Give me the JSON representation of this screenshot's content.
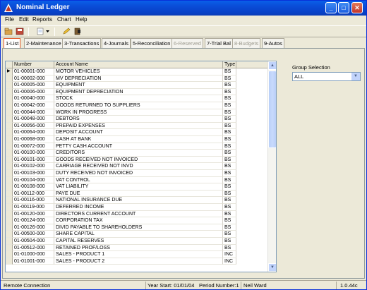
{
  "window": {
    "title": "Nominal Ledger"
  },
  "titlebar_buttons": {
    "minimize": "_",
    "maximize": "□",
    "close": "✕"
  },
  "menu": [
    {
      "label": "File"
    },
    {
      "label": "Edit"
    },
    {
      "label": "Reports"
    },
    {
      "label": "Chart"
    },
    {
      "label": "Help"
    }
  ],
  "toolbar": {
    "icons": [
      "open-icon",
      "save-icon",
      "new-document-icon",
      "dropdown-arrow-icon",
      "pencil-icon",
      "exit-icon"
    ]
  },
  "tabs": [
    {
      "label": "1-List",
      "state": "active"
    },
    {
      "label": "2-Maintenance",
      "state": "normal"
    },
    {
      "label": "3-Transactions",
      "state": "normal"
    },
    {
      "label": "4-Journals",
      "state": "normal"
    },
    {
      "label": "5-Reconciliation",
      "state": "normal"
    },
    {
      "label": "6-Reserved",
      "state": "disabled"
    },
    {
      "label": "7-Trial Bal",
      "state": "normal"
    },
    {
      "label": "8-Budgets",
      "state": "disabled"
    },
    {
      "label": "9-Autos",
      "state": "normal"
    }
  ],
  "grid": {
    "columns": [
      "Number",
      "Account Name",
      "Type"
    ],
    "rows": [
      [
        "01-00001-000",
        "MOTOR VEHICLES",
        "BS"
      ],
      [
        "01-00002-000",
        "MV DEPRECIATION",
        "BS"
      ],
      [
        "01-00005-000",
        "EQUIPMENT",
        "BS"
      ],
      [
        "01-00006-000",
        "EQUIPMENT DEPRECIATION",
        "BS"
      ],
      [
        "01-00040-000",
        "STOCK",
        "BS"
      ],
      [
        "01-00042-000",
        "GOODS RETURNED TO SUPPLIERS",
        "BS"
      ],
      [
        "01-00044-000",
        "WORK IN PROGRESS",
        "BS"
      ],
      [
        "01-00048-000",
        "DEBTORS",
        "BS"
      ],
      [
        "01-00056-000",
        "PREPAID EXPENSES",
        "BS"
      ],
      [
        "01-00064-000",
        "DEPOSIT ACCOUNT",
        "BS"
      ],
      [
        "01-00068-000",
        "CASH AT BANK",
        "BS"
      ],
      [
        "01-00072-000",
        "PETTY CASH ACCOUNT",
        "BS"
      ],
      [
        "01-00100-000",
        "CREDITORS",
        "BS"
      ],
      [
        "01-00101-000",
        "GOODS RECEIVED NOT  INVOICED",
        "BS"
      ],
      [
        "01-00102-000",
        "CARRIAGE RECEIVED NOT  INVD",
        "BS"
      ],
      [
        "01-00103-000",
        "DUTY RECEIVED NOT  INVOICED",
        "BS"
      ],
      [
        "01-00104-000",
        "VAT CONTROL",
        "BS"
      ],
      [
        "01-00108-000",
        "VAT LIABILITY",
        "BS"
      ],
      [
        "01-00112-000",
        "PAYE DUE",
        "BS"
      ],
      [
        "01-00116-000",
        "NATIONAL INSURANCE DUE",
        "BS"
      ],
      [
        "01-00119-000",
        "DEFERRED INCOME",
        "BS"
      ],
      [
        "01-00120-000",
        "DIRECTORS CURRENT ACCOUNT",
        "BS"
      ],
      [
        "01-00124-000",
        "CORPORATION TAX",
        "BS"
      ],
      [
        "01-00126-000",
        "DIVID PAYABLE TO SHAREHOLDERS",
        "BS"
      ],
      [
        "01-00500-000",
        "SHARE CAPITAL",
        "BS"
      ],
      [
        "01-00504-000",
        "CAPITAL RESERVES",
        "BS"
      ],
      [
        "01-00512-000",
        "RETAINED PROF/LOSS",
        "BS"
      ],
      [
        "01-01000-000",
        "SALES - PRODUCT 1",
        "INC"
      ],
      [
        "01-01001-000",
        "SALES - PRODUCT 2",
        "INC"
      ]
    ],
    "current_row_indicator": "▶"
  },
  "group_selection": {
    "label": "Group Selection",
    "value": "ALL"
  },
  "status": {
    "connection": "Remote Connection",
    "year_start": "Year Start: 01/01/04",
    "period": "Period Number:1",
    "user": "Neil Ward",
    "version": "1.0.44c"
  }
}
